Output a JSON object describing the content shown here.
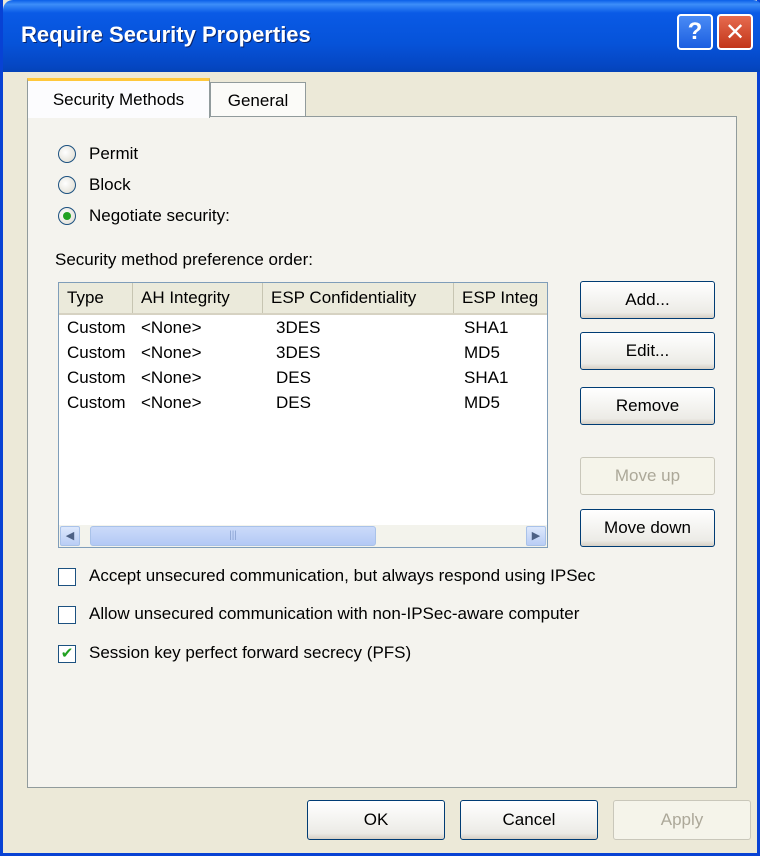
{
  "window": {
    "title": "Require Security Properties",
    "help_icon": "?",
    "close_icon": "✕"
  },
  "tabs": [
    {
      "label": "Security Methods",
      "active": true
    },
    {
      "label": "General",
      "active": false
    }
  ],
  "actions": {
    "options": [
      {
        "label": "Permit",
        "checked": false
      },
      {
        "label": "Block",
        "checked": false
      },
      {
        "label": "Negotiate security:",
        "checked": true
      }
    ]
  },
  "methods": {
    "label": "Security method preference order:",
    "columns": [
      "Type",
      "AH Integrity",
      "ESP Confidentiality",
      "ESP Integ"
    ],
    "rows": [
      [
        "Custom",
        "<None>",
        "3DES",
        "SHA1"
      ],
      [
        "Custom",
        "<None>",
        "3DES",
        "MD5"
      ],
      [
        "Custom",
        "<None>",
        "DES",
        "SHA1"
      ],
      [
        "Custom",
        "<None>",
        "DES",
        "MD5"
      ]
    ],
    "scroll_left": "◀",
    "scroll_right": "▶",
    "scroll_grip": "|||"
  },
  "side_buttons": {
    "add": "Add...",
    "edit": "Edit...",
    "remove": "Remove",
    "move_up": "Move up",
    "move_down": "Move down"
  },
  "checkboxes": [
    {
      "label": "Accept unsecured communication, but always respond using IPSec",
      "checked": false
    },
    {
      "label": "Allow unsecured communication with non-IPSec-aware computer",
      "checked": false
    },
    {
      "label": "Session key perfect forward secrecy (PFS)",
      "checked": true
    }
  ],
  "footer": {
    "ok": "OK",
    "cancel": "Cancel",
    "apply": "Apply"
  },
  "colors": {
    "titlebar": "#0653d9",
    "dialog": "#ece9d8",
    "check": "#21a121"
  }
}
